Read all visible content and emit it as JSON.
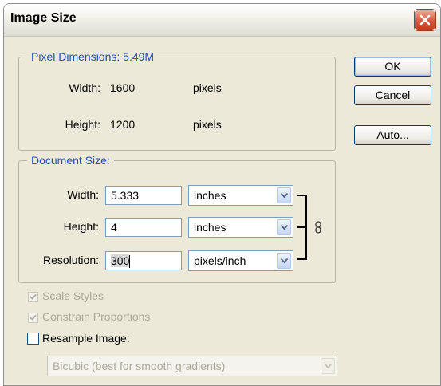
{
  "window": {
    "title": "Image Size"
  },
  "pixel_dimensions": {
    "legend": "Pixel Dimensions:  5.49M",
    "width_label": "Width:",
    "width_value": "1600",
    "width_unit": "pixels",
    "height_label": "Height:",
    "height_value": "1200",
    "height_unit": "pixels"
  },
  "document_size": {
    "legend": "Document Size:",
    "width_label": "Width:",
    "width_value": "5.333",
    "width_unit": "inches",
    "height_label": "Height:",
    "height_value": "4",
    "height_unit": "inches",
    "resolution_label": "Resolution:",
    "resolution_value": "300",
    "resolution_unit": "pixels/inch"
  },
  "buttons": {
    "ok": "OK",
    "cancel": "Cancel",
    "auto": "Auto..."
  },
  "options": {
    "scale_styles": {
      "label": "Scale Styles",
      "checked": true,
      "enabled": false
    },
    "constrain_proportions": {
      "label": "Constrain Proportions",
      "checked": true,
      "enabled": false
    },
    "resample_image": {
      "label": "Resample Image:",
      "checked": false,
      "enabled": true
    },
    "resample_method": {
      "value": "Bicubic (best for smooth gradients)",
      "enabled": false
    }
  },
  "colors": {
    "legend": "#1f4fc7",
    "dialog_bg": "#ece9d8",
    "close_red": "#d8583f"
  },
  "icons": {
    "close": "close-icon",
    "link": "chain-link-icon",
    "dropdown": "chevron-down-icon",
    "check": "check-icon"
  }
}
